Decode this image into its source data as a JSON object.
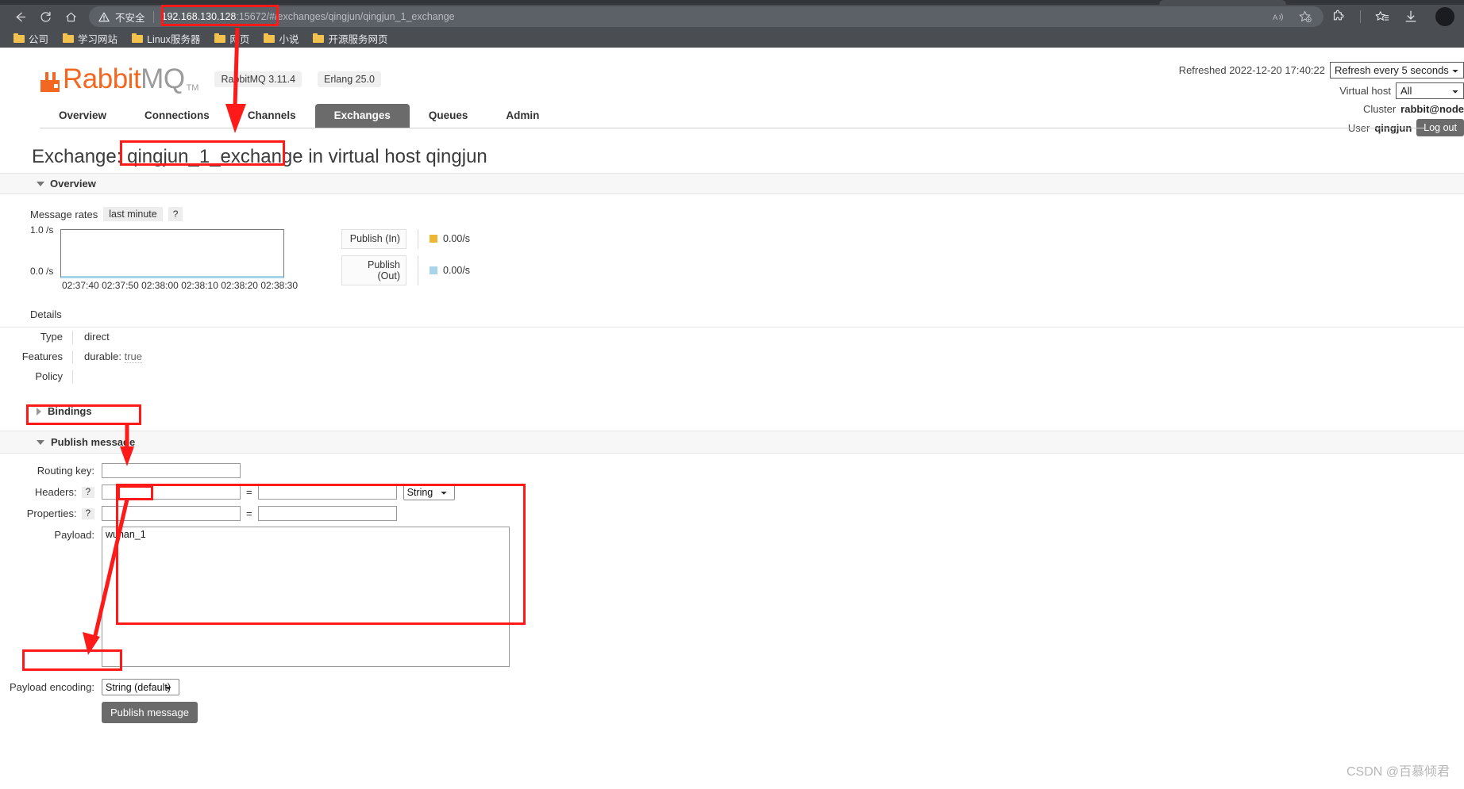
{
  "browser": {
    "nav": {
      "back": "back-arrow",
      "reload": "reload",
      "home": "home"
    },
    "security_warning": "不安全",
    "url_host": "192.168.130.128",
    "url_port_hash": ":15672/#",
    "url_path": "/exchanges/qingjun/qingjun_1_exchange",
    "bookmarks": [
      {
        "label": "公司"
      },
      {
        "label": "学习网站"
      },
      {
        "label": "Linux服务器"
      },
      {
        "label": "网页"
      },
      {
        "label": "小说"
      },
      {
        "label": "开源服务网页"
      }
    ],
    "toolbar_icons": [
      "read-aloud-icon",
      "add-favorite-icon",
      "extensions-icon",
      "favorites-icon",
      "downloads-icon",
      "profile-avatar"
    ]
  },
  "header": {
    "logo_rab": "Rabbit",
    "logo_mq": "MQ",
    "logo_tm": "TM",
    "version_rabbitmq": "RabbitMQ 3.11.4",
    "version_erlang": "Erlang 25.0",
    "refreshed": "Refreshed 2022-12-20 17:40:22",
    "refresh_select": "Refresh every 5 seconds",
    "vhost_label": "Virtual host",
    "vhost_value": "All",
    "cluster_label": "Cluster",
    "cluster_value": "rabbit@node",
    "user_label": "User",
    "user_value": "qingjun",
    "logout_label": "Log out"
  },
  "tabs": [
    {
      "label": "Overview",
      "active": false
    },
    {
      "label": "Connections",
      "active": false
    },
    {
      "label": "Channels",
      "active": false
    },
    {
      "label": "Exchanges",
      "active": true
    },
    {
      "label": "Queues",
      "active": false
    },
    {
      "label": "Admin",
      "active": false
    }
  ],
  "title": {
    "prefix": "Exchange: ",
    "exchange_name": "qingjun_1_exchange",
    "middle": " in virtual host ",
    "vhost": "qingjun"
  },
  "overview_section": {
    "label": "Overview",
    "message_rates_label": "Message rates",
    "period_pill": "last minute",
    "help": "?"
  },
  "chart_data": {
    "type": "line",
    "title": "Message rates",
    "xlabel": "",
    "ylabel": "/s",
    "ylim": [
      0.0,
      1.0
    ],
    "ytick_labels": [
      "1.0 /s",
      "0.0 /s"
    ],
    "x": [
      "02:37:40",
      "02:37:50",
      "02:38:00",
      "02:38:10",
      "02:38:20",
      "02:38:30"
    ],
    "series": [
      {
        "name": "Publish (In)",
        "color": "#edb733",
        "value_label": "0.00/s",
        "values": [
          0,
          0,
          0,
          0,
          0,
          0
        ]
      },
      {
        "name": "Publish (Out)",
        "color": "#a8d4ea",
        "value_label": "0.00/s",
        "values": [
          0,
          0,
          0,
          0,
          0,
          0
        ]
      }
    ],
    "grid": false,
    "legend": "right"
  },
  "details": {
    "label": "Details",
    "rows": [
      {
        "key": "Type",
        "value": "direct",
        "type": "plain"
      },
      {
        "key": "Features",
        "value_key": "durable:",
        "value": "true",
        "type": "kv"
      },
      {
        "key": "Policy",
        "value": "",
        "type": "plain"
      }
    ]
  },
  "bindings": {
    "label": "Bindings"
  },
  "publish": {
    "section_label": "Publish message",
    "routing_key_label": "Routing key:",
    "routing_key_value": "",
    "headers_label": "Headers:",
    "headers_help": "?",
    "headers_name": "",
    "headers_eq": "=",
    "headers_value": "",
    "headers_type": "String",
    "properties_label": "Properties:",
    "properties_help": "?",
    "properties_name": "",
    "properties_eq": "=",
    "properties_value": "",
    "payload_label": "Payload:",
    "payload_value": "wuhan_1",
    "encoding_label": "Payload encoding:",
    "encoding_value": "String (default)",
    "submit_label": "Publish message"
  },
  "watermark": "CSDN @百慕倾君",
  "colors": {
    "accent": "#f26722",
    "tab_active_bg": "#6b6b6b",
    "annotation_red": "#ff1a1a",
    "publish_in": "#edb733",
    "publish_out": "#a8d4ea"
  }
}
